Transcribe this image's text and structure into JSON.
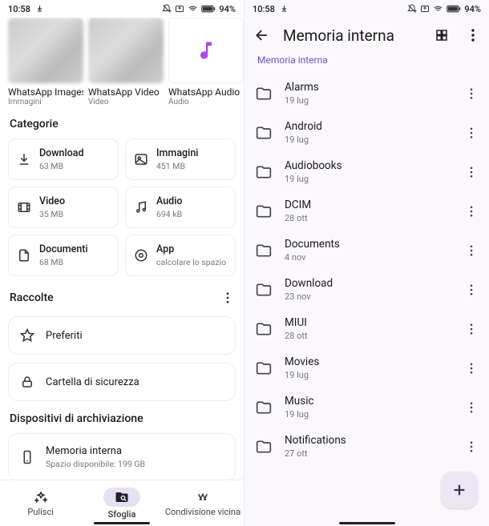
{
  "status": {
    "time": "10:58",
    "battery": "94%"
  },
  "left": {
    "recent": [
      {
        "title": "WhatsApp Images",
        "sub": "Immagini",
        "kind": "images"
      },
      {
        "title": "WhatsApp Video",
        "sub": "Video",
        "kind": "video"
      },
      {
        "title": "WhatsApp Audio",
        "sub": "Audio",
        "kind": "audio"
      }
    ],
    "categories_label": "Categorie",
    "categories": [
      {
        "icon": "download",
        "title": "Download",
        "sub": "63 MB"
      },
      {
        "icon": "image",
        "title": "Immagini",
        "sub": "451 MB"
      },
      {
        "icon": "video",
        "title": "Video",
        "sub": "35 MB"
      },
      {
        "icon": "audio",
        "title": "Audio",
        "sub": "694 kB"
      },
      {
        "icon": "document",
        "title": "Documenti",
        "sub": "68 MB"
      },
      {
        "icon": "app",
        "title": "App",
        "sub": "calcolare lo spazio"
      }
    ],
    "collections_label": "Raccolte",
    "collections": [
      {
        "icon": "star",
        "title": "Preferiti"
      },
      {
        "icon": "lock",
        "title": "Cartella di sicurezza"
      }
    ],
    "storage_label": "Dispositivi di archiviazione",
    "storage": {
      "title": "Memoria interna",
      "sub": "Spazio disponibile: 199 GB"
    },
    "nav": {
      "clean": "Pulisci",
      "browse": "Sfoglia",
      "share": "Condivisione vicinanze"
    }
  },
  "right": {
    "title": "Memoria interna",
    "breadcrumb": "Memoria interna",
    "folders": [
      {
        "name": "Alarms",
        "date": "19 lug"
      },
      {
        "name": "Android",
        "date": "19 lug"
      },
      {
        "name": "Audiobooks",
        "date": "19 lug"
      },
      {
        "name": "DCIM",
        "date": "28 ott"
      },
      {
        "name": "Documents",
        "date": "4 nov"
      },
      {
        "name": "Download",
        "date": "23 nov"
      },
      {
        "name": "MIUI",
        "date": "28 ott"
      },
      {
        "name": "Movies",
        "date": "19 lug"
      },
      {
        "name": "Music",
        "date": "19 lug"
      },
      {
        "name": "Notifications",
        "date": "27 ott"
      }
    ]
  }
}
